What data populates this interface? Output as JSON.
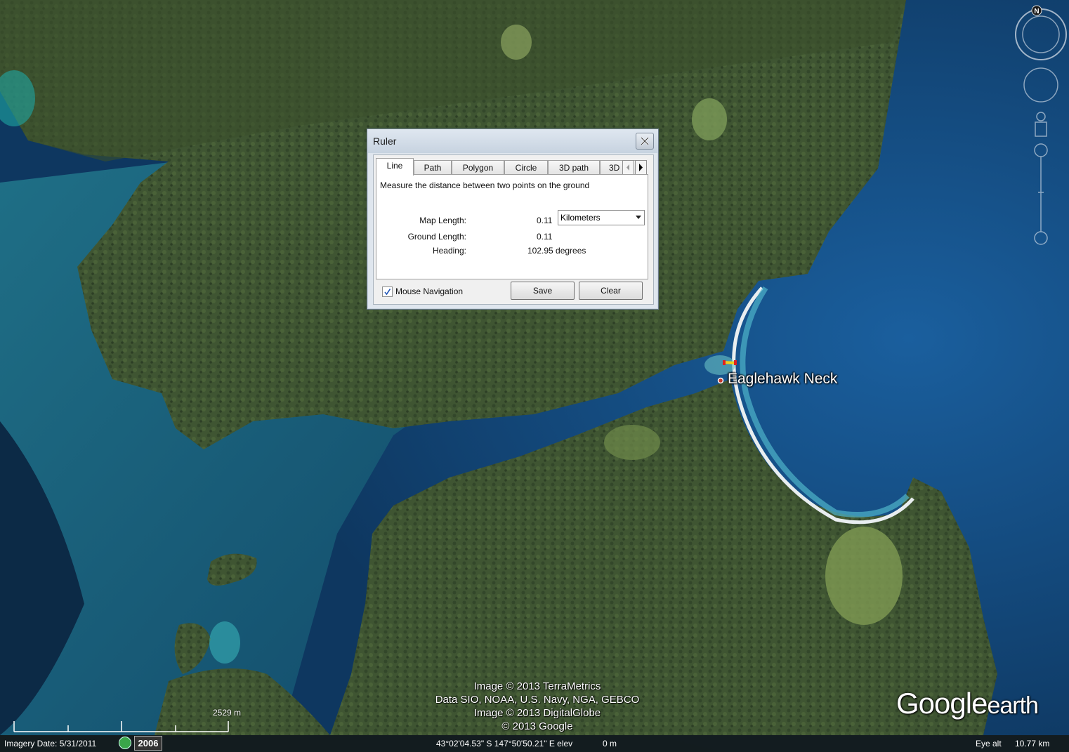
{
  "map": {
    "place_label": "Eaglehawk Neck",
    "credits": [
      "Image © 2013 TerraMetrics",
      "Data SIO, NOAA, U.S. Navy, NGA, GEBCO",
      "Image © 2013 DigitalGlobe",
      "© 2013 Google"
    ],
    "logo_main": "Google",
    "logo_sub": "earth",
    "scale_label": "2529 m",
    "compass_letter": "N"
  },
  "ruler": {
    "title": "Ruler",
    "tabs": [
      "Line",
      "Path",
      "Polygon",
      "Circle",
      "3D path",
      "3D"
    ],
    "active_tab": "Line",
    "description": "Measure the distance between two points on the ground",
    "map_length_label": "Map Length:",
    "map_length_value": "0.11",
    "unit": "Kilometers",
    "ground_length_label": "Ground Length:",
    "ground_length_value": "0.11",
    "heading_label": "Heading:",
    "heading_value": "102.95 degrees",
    "mouse_nav_label": "Mouse Navigation",
    "mouse_nav_checked": true,
    "save_label": "Save",
    "clear_label": "Clear"
  },
  "status_bar": {
    "imagery_date": "Imagery Date: 5/31/2011",
    "history_year": "2006",
    "coordinates": "43°02'04.53\" S 147°50'50.21\" E elev",
    "elevation": "0 m",
    "eye_alt_label": "Eye alt",
    "eye_alt_value": "10.77 km"
  },
  "colors": {
    "water_deep": "#0f3a66",
    "water_shallow": "#1d7f96",
    "land": "#3e5330",
    "beach": "#e9eef0",
    "ruler_line": "#f2d01a"
  }
}
